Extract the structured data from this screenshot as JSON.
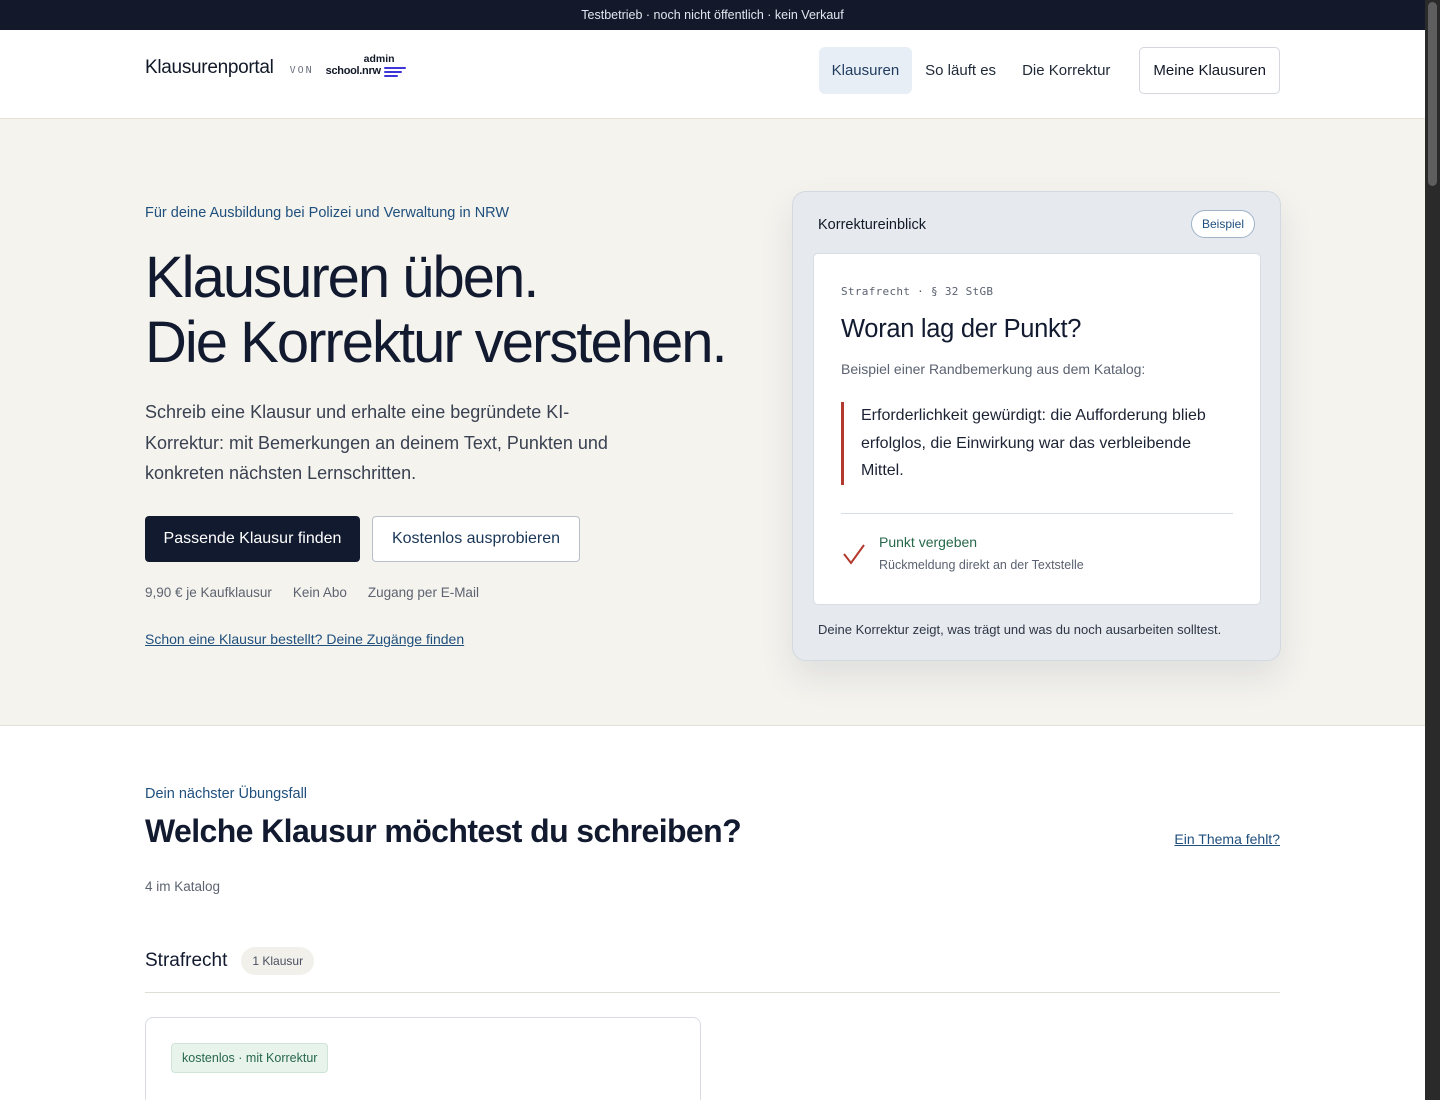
{
  "topbar": {
    "notice": "Testbetrieb · noch nicht öffentlich · kein Verkauf"
  },
  "header": {
    "brand": "Klausurenportal",
    "by": "VON",
    "partner_logo": {
      "top": "admin",
      "bottom": "school.nrw",
      "accent": "#3d34d9"
    },
    "nav": [
      {
        "label": "Klausuren",
        "active": true
      },
      {
        "label": "So läuft es",
        "active": false
      },
      {
        "label": "Die Korrektur",
        "active": false
      }
    ],
    "cta": "Meine Klausuren"
  },
  "hero": {
    "eyebrow": "Für deine Ausbildung bei Polizei und Verwaltung in NRW",
    "title_line1": "Klausuren üben.",
    "title_line2": "Die Korrektur verstehen.",
    "lead": "Schreib eine Klausur und erhalte eine begründete KI-Korrektur: mit Bemerkungen an deinem Text, Punkten und konkreten nächsten Lernschritten.",
    "primary_button": "Passende Klausur finden",
    "secondary_button": "Kostenlos ausprobieren",
    "facts": [
      "9,90 € je Kaufklausur",
      "Kein Abo",
      "Zugang per E-Mail"
    ],
    "link": "Schon eine Klausur bestellt? Deine Zugänge finden"
  },
  "preview_card": {
    "title": "Korrektureinblick",
    "badge": "Beispiel",
    "meta": "Strafrecht · § 32 StGB",
    "heading": "Woran lag der Punkt?",
    "subheading": "Beispiel einer Randbemerkung aus dem Katalog:",
    "quote": "Erforderlichkeit gewürdigt: die Aufforderung blieb erfolglos, die Einwirkung war das verbleibende Mittel.",
    "check_icon": "checkmark-icon",
    "result_title": "Punkt vergeben",
    "result_sub": "Rückmeldung direkt an der Textstelle",
    "footer": "Deine Korrektur zeigt, was trägt und was du noch ausarbeiten solltest."
  },
  "catalog": {
    "eyebrow": "Dein nächster Übungsfall",
    "title": "Welche Klausur möchtest du schreiben?",
    "missing_link": "Ein Thema fehlt?",
    "count": "4 im Katalog",
    "subjects": [
      {
        "name": "Strafrecht",
        "badge": "1 Klausur",
        "exams": [
          {
            "tag": "kostenlos · mit Korrektur"
          }
        ]
      }
    ]
  },
  "colors": {
    "dark": "#121a30",
    "accent_blue": "#1f4f7d",
    "quote_bar": "#b3392e",
    "success": "#27684a",
    "hero_bg": "#f4f3ee"
  }
}
